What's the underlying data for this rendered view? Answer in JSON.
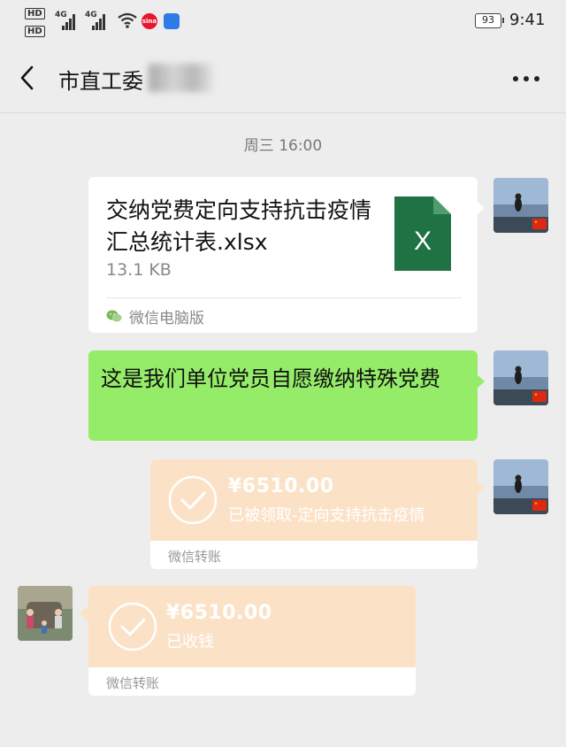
{
  "status_bar": {
    "hd1": "HD",
    "hd2": "HD",
    "network1": "4G",
    "network2": "4G",
    "app_badge": "sina",
    "battery": "93",
    "time": "9:41"
  },
  "nav": {
    "title": "市直工委",
    "back_icon": "chevron-left-icon",
    "more_icon": "more-dots-icon"
  },
  "timestamp": "周三 16:00",
  "messages": {
    "file": {
      "name": "交纳党费定向支持抗击疫情汇总统计表.xlsx",
      "size": "13.1 KB",
      "source": "微信电脑版",
      "icon_letter": "X",
      "icon_color": "#1f7244"
    },
    "text": {
      "content": "这是我们单位党员自愿缴纳特殊党费",
      "bubble_color": "#95ec69"
    },
    "transfer_sent": {
      "amount": "¥6510.00",
      "description": "已被领取-定向支持抗击疫情",
      "source": "微信转账"
    },
    "transfer_received": {
      "amount": "¥6510.00",
      "description": "已收钱",
      "source": "微信转账"
    }
  },
  "colors": {
    "background": "#ededed",
    "transfer_bg": "#fbe2c7",
    "flag": "#de2910"
  }
}
